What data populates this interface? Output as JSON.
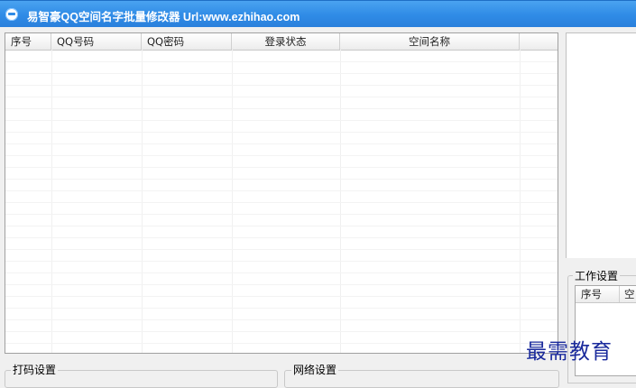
{
  "window": {
    "title": "易智豪QQ空间名字批量修改器 Url:www.ezhihao.com"
  },
  "main_table": {
    "columns": [
      "序号",
      "QQ号码",
      "QQ密码",
      "登录状态",
      "空间名称"
    ],
    "rows": []
  },
  "work_settings": {
    "legend": "工作设置",
    "columns": [
      "序号",
      "空"
    ]
  },
  "captcha_settings": {
    "legend": "打码设置"
  },
  "network_settings": {
    "legend": "网络设置"
  },
  "watermark": {
    "text": "最需教育"
  }
}
